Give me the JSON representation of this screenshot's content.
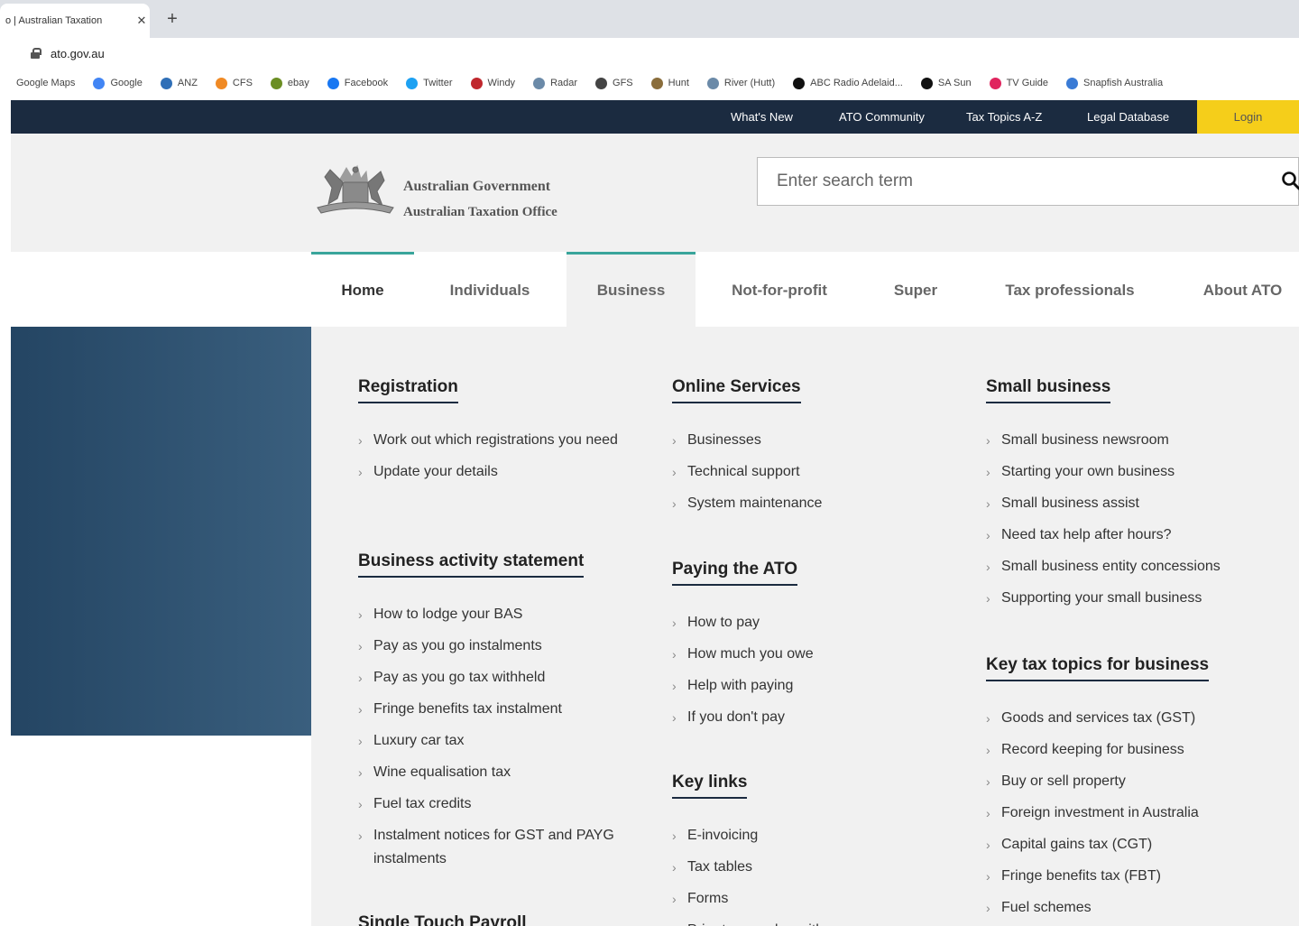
{
  "browser": {
    "tab_title": "o | Australian Taxation",
    "close_glyph": "✕",
    "new_tab_glyph": "+",
    "url": "ato.gov.au",
    "bookmarks": [
      {
        "label": "Google Maps",
        "color": ""
      },
      {
        "label": "Google",
        "color": "#4285f4"
      },
      {
        "label": "ANZ",
        "color": "#2f6fb7"
      },
      {
        "label": "CFS",
        "color": "#f08a24"
      },
      {
        "label": "ebay",
        "color": "#6b8e23"
      },
      {
        "label": "Facebook",
        "color": "#1877f2"
      },
      {
        "label": "Twitter",
        "color": "#1da1f2"
      },
      {
        "label": "Windy",
        "color": "#c0272d"
      },
      {
        "label": "Radar",
        "color": "#6b8aa8"
      },
      {
        "label": "GFS",
        "color": "#444444"
      },
      {
        "label": "Hunt",
        "color": "#8a6d3b"
      },
      {
        "label": "River (Hutt)",
        "color": "#6b8aa8"
      },
      {
        "label": "ABC Radio Adelaid...",
        "color": "#111111"
      },
      {
        "label": "SA Sun",
        "color": "#111111"
      },
      {
        "label": "TV Guide",
        "color": "#e0245e"
      },
      {
        "label": "Snapfish Australia",
        "color": "#3a7bd5"
      }
    ]
  },
  "utility_nav": {
    "whats_new": "What's New",
    "community": "ATO Community",
    "tax_topics": "Tax Topics A-Z",
    "legal_database": "Legal Database",
    "login": "Login"
  },
  "header": {
    "gov_name": "Australian Government",
    "office_name": "Australian Taxation Office",
    "search_placeholder": "Enter search term"
  },
  "main_nav": [
    "Home",
    "Individuals",
    "Business",
    "Not-for-profit",
    "Super",
    "Tax professionals",
    "About ATO"
  ],
  "mega_menu": {
    "registration": {
      "title": "Registration",
      "links": [
        "Work out which registrations you need",
        "Update your details"
      ]
    },
    "bas": {
      "title": "Business activity statement",
      "links": [
        "How to lodge your BAS",
        "Pay as you go instalments",
        "Pay as you go tax withheld",
        "Fringe benefits tax instalment",
        "Luxury car tax",
        "Wine equalisation tax",
        "Fuel tax credits",
        "Instalment notices for GST and PAYG instalments"
      ]
    },
    "stp": {
      "title": "Single Touch Payroll"
    },
    "online_services": {
      "title": "Online Services",
      "links": [
        "Businesses",
        "Technical support",
        "System maintenance"
      ]
    },
    "paying": {
      "title": "Paying the ATO",
      "links": [
        "How to pay",
        "How much you owe",
        "Help with paying",
        "If you don't pay"
      ]
    },
    "key_links": {
      "title": "Key links",
      "links": [
        "E-invoicing",
        "Tax tables",
        "Forms",
        "Prior to ... and ... with"
      ]
    },
    "small_business": {
      "title": "Small business",
      "links": [
        "Small business newsroom",
        "Starting your own business",
        "Small business assist",
        "Need tax help after hours?",
        "Small business entity concessions",
        "Supporting your small business"
      ]
    },
    "key_topics": {
      "title": "Key tax topics for business",
      "links": [
        "Goods and services tax (GST)",
        "Record keeping for business",
        "Buy or sell property",
        "Foreign investment in Australia",
        "Capital gains tax (CGT)",
        "Fringe benefits tax (FBT)",
        "Fuel schemes"
      ]
    }
  }
}
